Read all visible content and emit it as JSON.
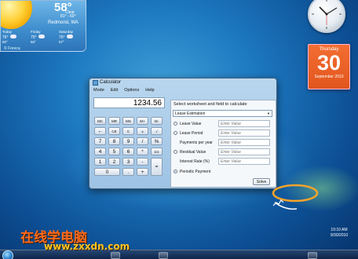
{
  "weather": {
    "temperature": "58°",
    "condition": "Clear",
    "range": "81° - 60°",
    "city": "Redmond, WA",
    "forecast": [
      {
        "day": "Today",
        "high": "76°",
        "low": "60°"
      },
      {
        "day": "Friday",
        "high": "75°",
        "low": "56°"
      },
      {
        "day": "Saturday",
        "high": "75°",
        "low": "57°"
      }
    ],
    "source": "© Foreca"
  },
  "calendar": {
    "weekday": "Thursday",
    "day": "30",
    "month_year": "September 2010"
  },
  "calculator": {
    "title": "Calculator",
    "menu": [
      "Mode",
      "Edit",
      "Options",
      "Help"
    ],
    "display": "1234.56",
    "keys": [
      [
        "MC",
        "MR",
        "MS",
        "M+",
        "M-"
      ],
      [
        "←",
        "CE",
        "C",
        "±",
        "√"
      ],
      [
        "7",
        "8",
        "9",
        "/",
        "%"
      ],
      [
        "4",
        "5",
        "6",
        "*",
        "1/x"
      ],
      [
        "1",
        "2",
        "3",
        "-",
        "="
      ],
      [
        "0",
        ".",
        "+"
      ]
    ],
    "worksheet": {
      "prompt": "Select worksheet and field to calculate",
      "selected": "Lease Estimation",
      "fields": [
        {
          "label": "Lease Value",
          "placeholder": "Enter Value",
          "has_radio": true,
          "selected": false
        },
        {
          "label": "Lease Period",
          "placeholder": "Enter Value",
          "has_radio": true,
          "selected": false
        },
        {
          "label": "Payments per year",
          "placeholder": "Enter Value",
          "has_radio": false,
          "selected": false
        },
        {
          "label": "Residual Value",
          "placeholder": "Enter Value",
          "has_radio": true,
          "selected": false
        },
        {
          "label": "Interest Rate (%)",
          "placeholder": "Enter Value",
          "has_radio": false,
          "selected": false
        },
        {
          "label": "Periodic Payment",
          "placeholder": "",
          "has_radio": true,
          "selected": true
        }
      ],
      "solve_label": "Solve"
    }
  },
  "tray": {
    "time": "10:10 AM",
    "date": "9/30/2010"
  },
  "caption": {
    "chinese": "在线学电脑",
    "url": "www.zxxdn.com"
  },
  "icons": {
    "start": "start-orb-icon",
    "clock": "analog-clock-icon",
    "sun": "sun-icon"
  }
}
